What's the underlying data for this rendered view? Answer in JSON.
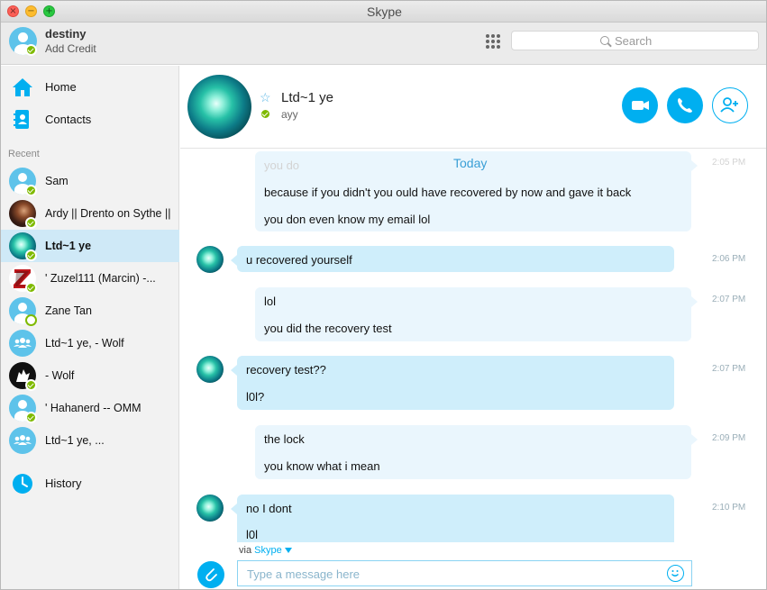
{
  "window": {
    "title": "Skype",
    "close_glyph": "×",
    "min_glyph": "−",
    "max_glyph": "+"
  },
  "profile": {
    "name": "destiny",
    "subtitle": "Add Credit"
  },
  "search": {
    "placeholder": "Search"
  },
  "nav": {
    "home": "Home",
    "contacts": "Contacts",
    "history": "History"
  },
  "recent": {
    "label": "Recent",
    "contacts": [
      {
        "name": "Sam",
        "avatar": "default-avatar",
        "status": "online"
      },
      {
        "name": "Ardy || Drento on Sythe ||",
        "avatar": "photo-avatar",
        "status": "online"
      },
      {
        "name": "Ltd~1 ye",
        "avatar": "teal-avatar",
        "status": "online"
      },
      {
        "name": "' Zuzel111 (Marcin) -...",
        "avatar": "z-logo-avatar",
        "status": "online"
      },
      {
        "name": "Zane Tan",
        "avatar": "default-avatar",
        "status": "offline"
      },
      {
        "name": "Ltd~1 ye, - Wolf",
        "avatar": "group-avatar",
        "status": "none"
      },
      {
        "name": "- Wolf",
        "avatar": "wolf-avatar",
        "status": "online"
      },
      {
        "name": "' Hahanerd -- OMM",
        "avatar": "default-avatar",
        "status": "online"
      },
      {
        "name": "Ltd~1 ye, ...",
        "avatar": "group-avatar",
        "status": "none"
      }
    ]
  },
  "conversation": {
    "name": "Ltd~1 ye",
    "mood": "ayy",
    "day_label": "Today",
    "messages": [
      {
        "side": "out",
        "lines": [
          "you do",
          "because if you didn't you ould have recovered by now and gave it back",
          "you don even know my email lol"
        ],
        "time": "2:05 PM"
      },
      {
        "side": "in",
        "lines": [
          "u recovered yourself"
        ],
        "time": "2:06 PM"
      },
      {
        "side": "out",
        "lines": [
          "lol",
          "you did the recovery test"
        ],
        "time": "2:07 PM"
      },
      {
        "side": "in",
        "lines": [
          "recovery test??",
          "l0l?"
        ],
        "time": "2:07 PM"
      },
      {
        "side": "out",
        "lines": [
          "the lock",
          "you know what i mean"
        ],
        "time": "2:09 PM"
      },
      {
        "side": "in",
        "lines": [
          "no I dont",
          "l0l"
        ],
        "time": "2:10 PM"
      }
    ]
  },
  "composer": {
    "via_prefix": "via",
    "via_service": "Skype",
    "placeholder": "Type a message here"
  },
  "colors": {
    "accent": "#00aff0",
    "online": "#7fba00",
    "incoming_bubble": "#cfeefb",
    "outgoing_bubble": "#eaf6fd"
  }
}
